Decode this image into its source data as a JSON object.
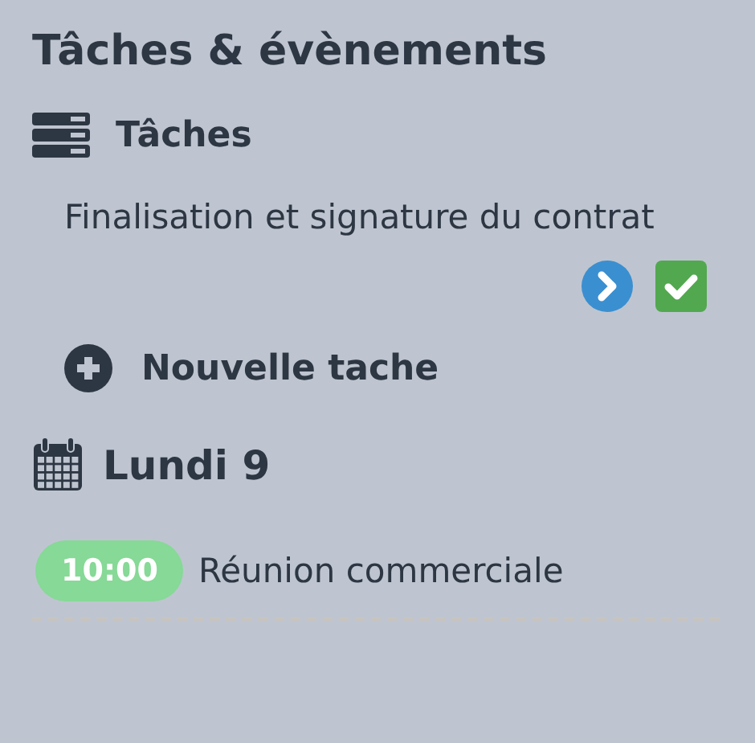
{
  "title": "Tâches & évènements",
  "tasks_section": {
    "heading": "Tâches",
    "tasks": [
      {
        "text": "Finalisation et signature du contrat"
      }
    ],
    "new_task": "Nouvelle tache"
  },
  "days": [
    {
      "heading": "Lundi 9",
      "events": [
        {
          "time": "10:00",
          "title": "Réunion commerciale",
          "color": "#86d996"
        }
      ]
    }
  ]
}
